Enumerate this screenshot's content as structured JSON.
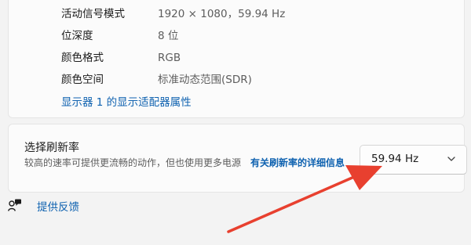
{
  "display_info": {
    "rows": [
      {
        "label": "活动信号模式",
        "value": "1920 × 1080，59.94 Hz"
      },
      {
        "label": "位深度",
        "value": "8 位"
      },
      {
        "label": "颜色格式",
        "value": "RGB"
      },
      {
        "label": "颜色空间",
        "value": "标准动态范围(SDR)"
      }
    ],
    "adapter_link": "显示器 1 的显示适配器属性"
  },
  "refresh_rate": {
    "title": "选择刷新率",
    "description": "较高的速率可提供更流畅的动作，但也使用更多电源",
    "more_link": "有关刷新率的详细信息",
    "selected": "59.94 Hz"
  },
  "feedback": {
    "label": "提供反馈"
  },
  "colors": {
    "accent_link": "#0f62b0",
    "arrow": "#e8402f"
  },
  "icons": {
    "dropdown": "chevron-down-icon",
    "feedback": "feedback-icon"
  }
}
